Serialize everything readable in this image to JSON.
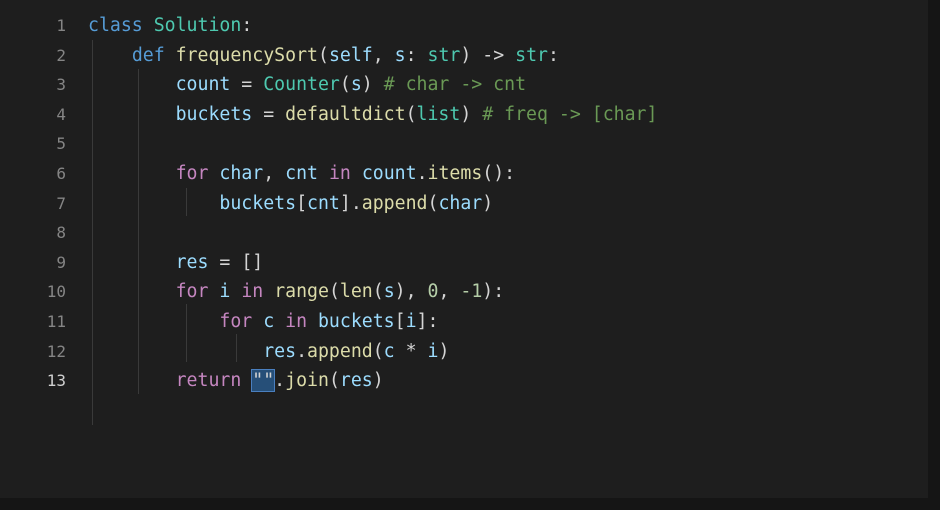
{
  "editor": {
    "lines": [
      {
        "num": "1",
        "tokens": [
          [
            "kw",
            "class "
          ],
          [
            "cls",
            "Solution"
          ],
          [
            "op",
            ":"
          ]
        ]
      },
      {
        "num": "2",
        "tokens": [
          [
            "op",
            "    "
          ],
          [
            "kw",
            "def "
          ],
          [
            "fn",
            "frequencySort"
          ],
          [
            "op",
            "("
          ],
          [
            "var",
            "self"
          ],
          [
            "op",
            ", "
          ],
          [
            "var",
            "s"
          ],
          [
            "op",
            ": "
          ],
          [
            "cls",
            "str"
          ],
          [
            "op",
            ") -> "
          ],
          [
            "cls",
            "str"
          ],
          [
            "op",
            ":"
          ]
        ]
      },
      {
        "num": "3",
        "tokens": [
          [
            "op",
            "        "
          ],
          [
            "var",
            "count"
          ],
          [
            "op",
            " = "
          ],
          [
            "cls",
            "Counter"
          ],
          [
            "op",
            "("
          ],
          [
            "var",
            "s"
          ],
          [
            "op",
            ") "
          ],
          [
            "cm",
            "# char -> cnt"
          ]
        ]
      },
      {
        "num": "4",
        "tokens": [
          [
            "op",
            "        "
          ],
          [
            "var",
            "buckets"
          ],
          [
            "op",
            " = "
          ],
          [
            "fn",
            "defaultdict"
          ],
          [
            "op",
            "("
          ],
          [
            "cls",
            "list"
          ],
          [
            "op",
            ") "
          ],
          [
            "cm",
            "# freq -> [char]"
          ]
        ]
      },
      {
        "num": "5",
        "tokens": []
      },
      {
        "num": "6",
        "tokens": [
          [
            "op",
            "        "
          ],
          [
            "kw2",
            "for "
          ],
          [
            "var",
            "char"
          ],
          [
            "op",
            ", "
          ],
          [
            "var",
            "cnt"
          ],
          [
            "kw2",
            " in "
          ],
          [
            "var",
            "count"
          ],
          [
            "op",
            "."
          ],
          [
            "fn",
            "items"
          ],
          [
            "op",
            "():"
          ]
        ]
      },
      {
        "num": "7",
        "tokens": [
          [
            "op",
            "            "
          ],
          [
            "var",
            "buckets"
          ],
          [
            "op",
            "["
          ],
          [
            "var",
            "cnt"
          ],
          [
            "op",
            "]."
          ],
          [
            "fn",
            "append"
          ],
          [
            "op",
            "("
          ],
          [
            "var",
            "char"
          ],
          [
            "op",
            ")"
          ]
        ]
      },
      {
        "num": "8",
        "tokens": []
      },
      {
        "num": "9",
        "tokens": [
          [
            "op",
            "        "
          ],
          [
            "var",
            "res"
          ],
          [
            "op",
            " = []"
          ]
        ]
      },
      {
        "num": "10",
        "tokens": [
          [
            "op",
            "        "
          ],
          [
            "kw2",
            "for "
          ],
          [
            "var",
            "i"
          ],
          [
            "kw2",
            " in "
          ],
          [
            "fn",
            "range"
          ],
          [
            "op",
            "("
          ],
          [
            "fn",
            "len"
          ],
          [
            "op",
            "("
          ],
          [
            "var",
            "s"
          ],
          [
            "op",
            "), "
          ],
          [
            "num",
            "0"
          ],
          [
            "op",
            ", "
          ],
          [
            "num",
            "-1"
          ],
          [
            "op",
            "):"
          ]
        ]
      },
      {
        "num": "11",
        "tokens": [
          [
            "op",
            "            "
          ],
          [
            "kw2",
            "for "
          ],
          [
            "var",
            "c"
          ],
          [
            "kw2",
            " in "
          ],
          [
            "var",
            "buckets"
          ],
          [
            "op",
            "["
          ],
          [
            "var",
            "i"
          ],
          [
            "op",
            "]:"
          ]
        ]
      },
      {
        "num": "12",
        "tokens": [
          [
            "op",
            "                "
          ],
          [
            "var",
            "res"
          ],
          [
            "op",
            "."
          ],
          [
            "fn",
            "append"
          ],
          [
            "op",
            "("
          ],
          [
            "var",
            "c"
          ],
          [
            "op",
            " * "
          ],
          [
            "var",
            "i"
          ],
          [
            "op",
            ")"
          ]
        ]
      },
      {
        "num": "13",
        "tokens": [
          [
            "op",
            "        "
          ],
          [
            "kw2",
            "return "
          ],
          [
            "sel",
            "\"\""
          ],
          [
            "op",
            "."
          ],
          [
            "fn",
            "join"
          ],
          [
            "op",
            "("
          ],
          [
            "var",
            "res"
          ],
          [
            "op",
            ")"
          ]
        ]
      }
    ],
    "active_line": "13",
    "colors": {
      "background": "#1e1e1e",
      "keyword": "#569cd6",
      "control": "#c586c0",
      "function": "#dcdcaa",
      "type": "#4ec9b0",
      "variable": "#9cdcfe",
      "comment": "#6a9955",
      "number": "#b5cea8",
      "selection": "#264f78"
    }
  }
}
